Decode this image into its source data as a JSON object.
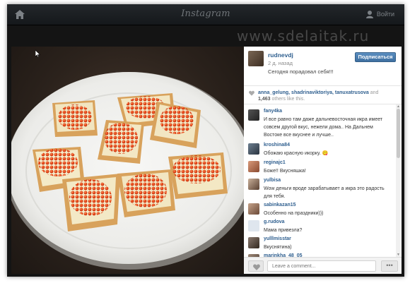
{
  "topbar": {
    "logo": "Instagram",
    "login_label": "Войти",
    "home_icon": "home-icon",
    "user_icon": "user-icon"
  },
  "watermark": "www.sdelaitak.ru",
  "post": {
    "username": "rudnevdj",
    "time": "2 д. назад",
    "caption": "Сегодня порадовал себя!!!",
    "follow_label": "Подписаться"
  },
  "likes": {
    "names": "anna_gelung, shadrinaviktoriya, tanuxatrusova",
    "and": "and",
    "count": "1,463",
    "suffix": "others like this."
  },
  "comments": [
    {
      "user": "fany4ka",
      "text": "И все равно там даже дальневосточная икра имеет совсем другой вкус, нежели дома.. На Дальнем Востоке все вкуснее и лучше.."
    },
    {
      "user": "kroshina84",
      "text": "Обожаю красную икорку. 😋"
    },
    {
      "user": "reginajc1",
      "text": "Боже!! Вкусняшка!"
    },
    {
      "user": "yulbisa",
      "text": "Wow деньги вроде зарабатывает а икра это радость для тебя."
    },
    {
      "user": "sabinkazan15",
      "text": "Особенно на праздники)))"
    },
    {
      "user": "g.rudova",
      "text": "Мама привезла?"
    },
    {
      "user": "yulllmisstar",
      "text": "Вкуснятина)"
    },
    {
      "user": "marinkha_48_05",
      "text": ""
    }
  ],
  "footer": {
    "comment_placeholder": "Leave a comment...",
    "more_label": "•••"
  },
  "colors": {
    "link": "#2f5f8f",
    "follow_button": "#4a7db0",
    "caviar": "#e0421a",
    "bread": "#d8a25c",
    "plate": "#f4f4f2"
  }
}
